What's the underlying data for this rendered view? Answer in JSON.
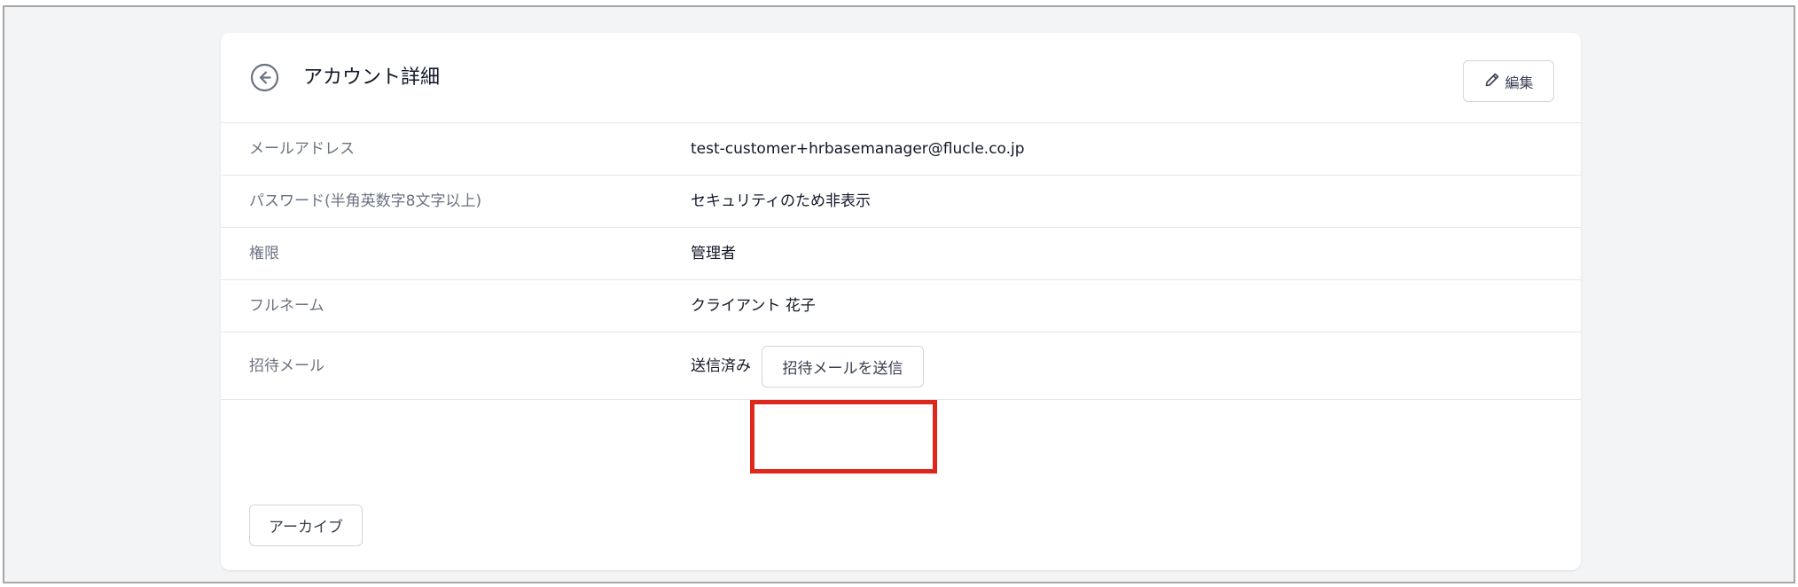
{
  "header": {
    "title": "アカウント詳細",
    "edit_label": "編集",
    "back_icon": "arrow-left-circle-icon",
    "edit_icon": "pencil-icon"
  },
  "fields": {
    "email": {
      "label": "メールアドレス",
      "value": "test-customer+hrbasemanager@flucle.co.jp"
    },
    "password": {
      "label": "パスワード(半角英数字8文字以上)",
      "value": "セキュリティのため非表示"
    },
    "role": {
      "label": "権限",
      "value": "管理者"
    },
    "fullname": {
      "label": "フルネーム",
      "value": "クライアント 花子"
    },
    "invite": {
      "label": "招待メール",
      "value": "送信済み",
      "button_label": "招待メールを送信"
    }
  },
  "footer": {
    "archive_label": "アーカイブ"
  },
  "colors": {
    "page_background": "#f3f4f6",
    "card_background": "#ffffff",
    "highlight": "#e0271c",
    "label_text": "#6b7280",
    "value_text": "#111827",
    "border": "#e5e7eb"
  }
}
